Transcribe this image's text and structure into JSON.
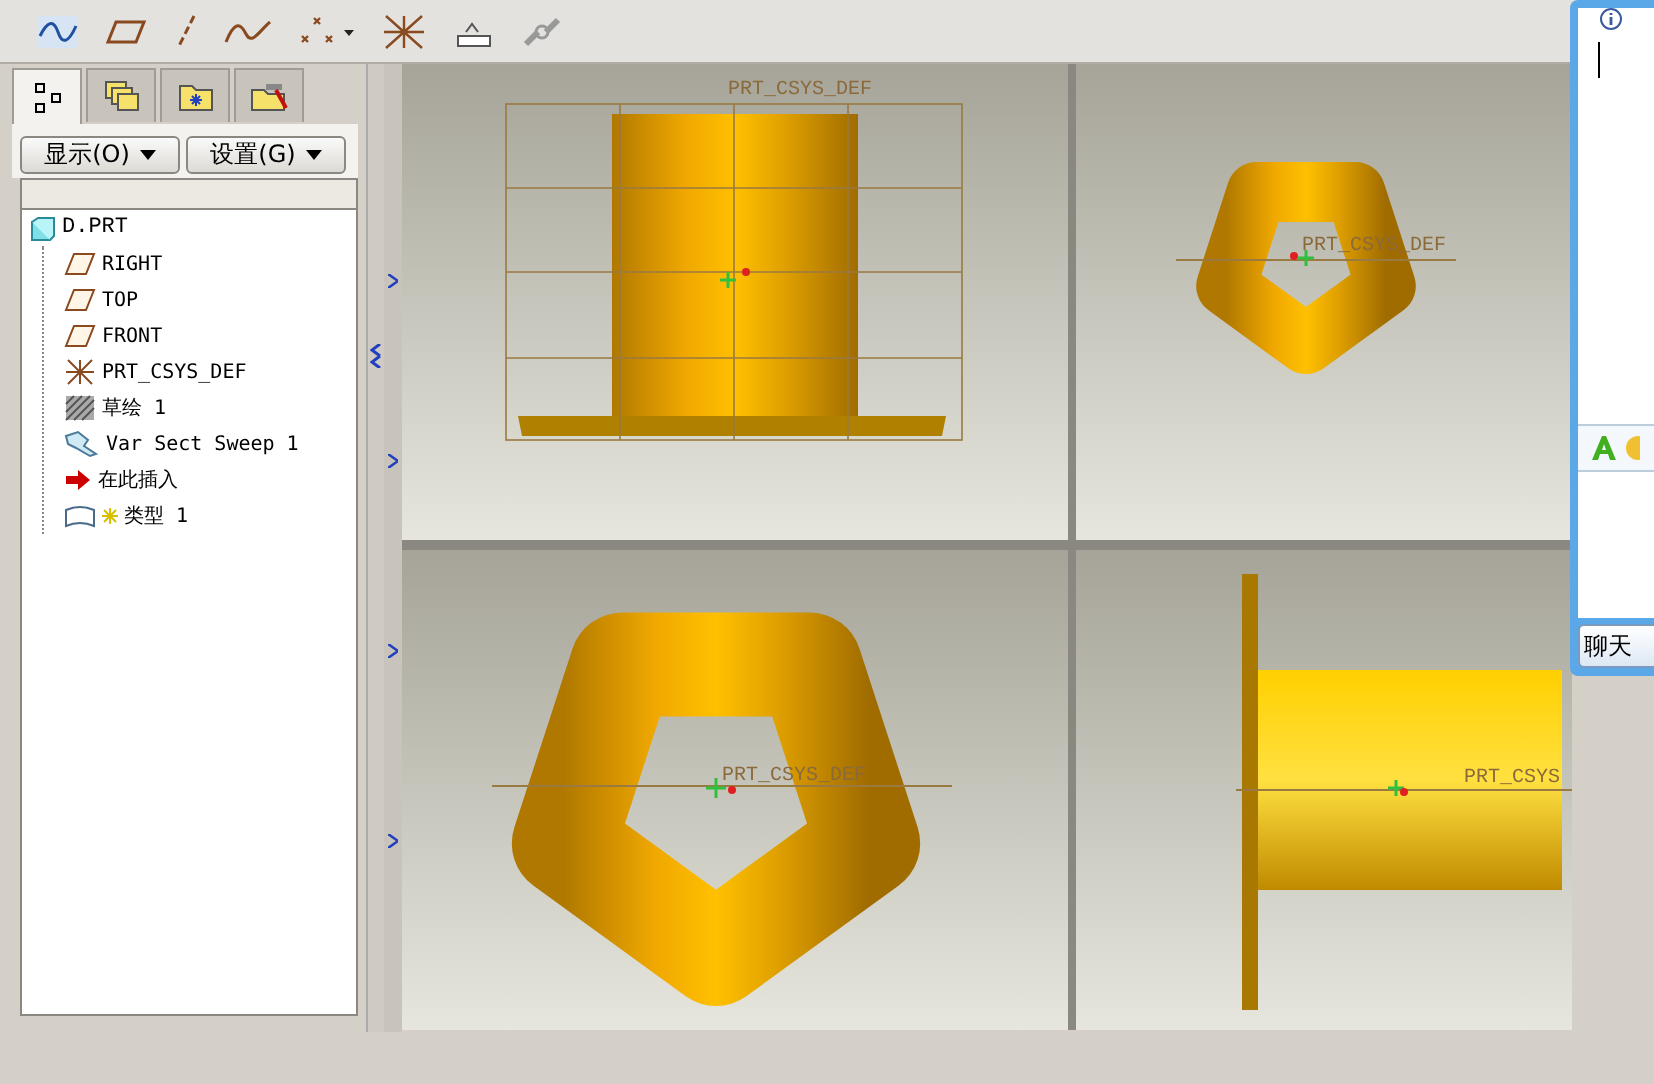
{
  "panel_tabs": [
    {
      "kind": "tree",
      "selected": true
    },
    {
      "kind": "layers",
      "selected": false
    },
    {
      "kind": "folder",
      "selected": false
    },
    {
      "kind": "tools",
      "selected": false
    }
  ],
  "dropdowns": [
    {
      "label": "显示(O)"
    },
    {
      "label": "设置(G)"
    }
  ],
  "tree": {
    "label": "D.PRT",
    "kind": "part",
    "children": [
      {
        "label": "RIGHT",
        "kind": "plane"
      },
      {
        "label": "TOP",
        "kind": "plane"
      },
      {
        "label": "FRONT",
        "kind": "plane"
      },
      {
        "label": "PRT_CSYS_DEF",
        "kind": "csys"
      },
      {
        "label": "草绘 1",
        "kind": "sketch"
      },
      {
        "label": "Var Sect Sweep 1",
        "kind": "sweep"
      },
      {
        "label": "在此插入",
        "kind": "insert"
      },
      {
        "label": "类型 1",
        "kind": "type"
      }
    ]
  },
  "views": [
    {
      "kind": "side",
      "csys_label": "PRT_CSYS_DEF"
    },
    {
      "kind": "top",
      "csys_label": "PRT_CSYS_DEF"
    },
    {
      "kind": "top-large",
      "csys_label": "PRT_CSYS_DEF"
    },
    {
      "kind": "front",
      "csys_label": "PRT_CSYS"
    }
  ],
  "chat": {
    "button": "聊天"
  }
}
